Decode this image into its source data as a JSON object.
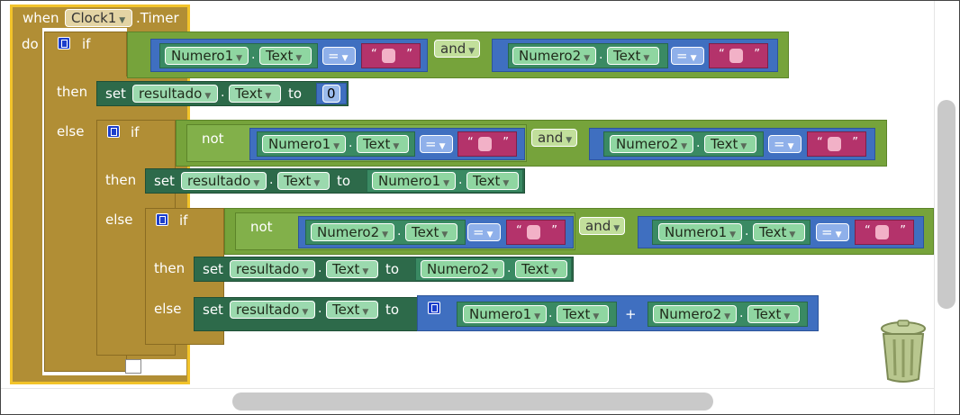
{
  "event": {
    "when": "when",
    "component": "Clock1",
    "event": ".Timer",
    "do": "do"
  },
  "keywords": {
    "if": "if",
    "then": "then",
    "else": "else",
    "and": "and",
    "not": "not",
    "set": "set",
    "to": "to",
    "dot": ".",
    "plus": "+"
  },
  "components": {
    "numero1": "Numero1",
    "numero2": "Numero2",
    "resultado": "resultado"
  },
  "props": {
    "text": "Text"
  },
  "ops": {
    "eq": "="
  },
  "quote": {
    "open": "“",
    "close": "”"
  },
  "values": {
    "zero": "0"
  },
  "icons": {
    "trash": "trash-can-icon",
    "mutator": "mutator-gear-icon",
    "dropdown": "dropdown-arrow-icon"
  },
  "colors": {
    "control": "#b18e35",
    "logic": "#76a33b",
    "compare": "#3f6fc0",
    "set": "#2d6a4a",
    "field": "#8fd6a1",
    "text_string": "#b4336b",
    "highlight": "#f2c32a"
  }
}
